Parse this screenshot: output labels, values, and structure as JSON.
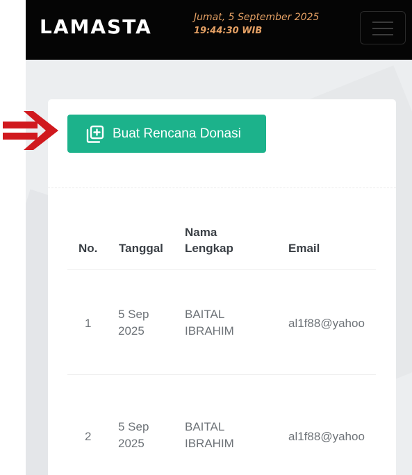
{
  "header": {
    "logo": "LAMASTA",
    "date": "Jumat, 5 September 2025",
    "time": "19:44:30 WIB",
    "menu_icon": "hamburger-icon"
  },
  "annotation": {
    "arrow_icon": "red-arrow-right-icon",
    "color": "#d0191e"
  },
  "card": {
    "create_button_label": "Buat Rencana Donasi",
    "create_button_icon": "add-square-icon",
    "accent": "#1cb28b"
  },
  "table": {
    "columns": [
      "No.",
      "Tanggal",
      "Nama Lengkap",
      "Email"
    ],
    "rows": [
      {
        "no": "1",
        "tanggal": "5 Sep 2025",
        "nama": "BAITAL IBRAHIM",
        "email": "al1f88@yahoo"
      },
      {
        "no": "2",
        "tanggal": "5 Sep 2025",
        "nama": "BAITAL IBRAHIM",
        "email": "al1f88@yahoo"
      }
    ]
  }
}
